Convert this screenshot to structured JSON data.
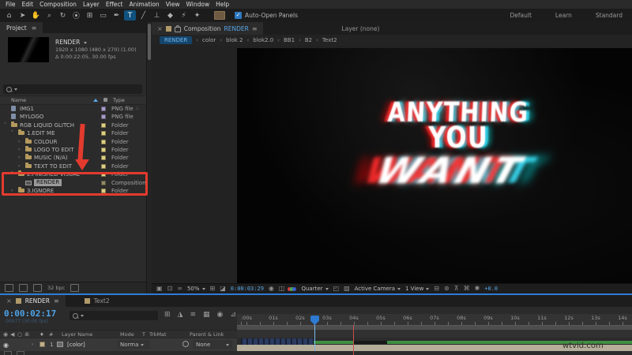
{
  "accent": {
    "blue": "#58a6e8",
    "red_annotation": "#e23b2e",
    "selection_blue": "#2e7cd6"
  },
  "menu_bar": {
    "items": [
      "File",
      "Edit",
      "Composition",
      "Layer",
      "Effect",
      "Animation",
      "View",
      "Window",
      "Help"
    ]
  },
  "toolbar": {
    "tools": [
      {
        "name": "home-tool",
        "glyph": "⌂",
        "active": false
      },
      {
        "name": "selection-tool",
        "glyph": "➤",
        "active": false
      },
      {
        "name": "hand-tool",
        "glyph": "✋",
        "active": false
      },
      {
        "name": "zoom-tool",
        "glyph": "⌕",
        "active": false
      },
      {
        "name": "rotation-tool",
        "glyph": "↻",
        "active": false
      },
      {
        "name": "camera-tool",
        "glyph": "⦿",
        "active": false
      },
      {
        "name": "pan-behind-tool",
        "glyph": "⊞",
        "active": false
      },
      {
        "name": "shape-tool",
        "glyph": "▭",
        "active": false
      },
      {
        "name": "pen-tool",
        "glyph": "✒",
        "active": false
      },
      {
        "name": "type-tool",
        "glyph": "T",
        "active": true
      },
      {
        "name": "brush-tool",
        "glyph": "╱",
        "active": false
      },
      {
        "name": "clone-stamp-tool",
        "glyph": "⊥",
        "active": false
      },
      {
        "name": "eraser-tool",
        "glyph": "◆",
        "active": false
      },
      {
        "name": "roto-brush-tool",
        "glyph": "⚡",
        "active": false
      },
      {
        "name": "puppet-pin-tool",
        "glyph": "✦",
        "active": false
      }
    ],
    "checkmark": "✓",
    "auto_open_label": "Auto-Open Panels",
    "workspaces": [
      "Default",
      "Learn",
      "Standard"
    ]
  },
  "project_panel": {
    "tab": "Project",
    "panel_menu_glyph": "≡",
    "preview": {
      "name": "RENDER",
      "meta1": "1920 x 1080  (480 x 270) (1.00)",
      "meta2": "Δ 0:00:22:05, 30.00 fps"
    },
    "columns": {
      "name": "Name",
      "type": "Type"
    },
    "items": [
      {
        "label": "IMG1",
        "type": "PNG file",
        "icon": "png",
        "indent": 0,
        "twirl": "",
        "swatch": "#a89cc8",
        "selected": false,
        "net": true
      },
      {
        "label": "MYLOGO",
        "type": "PNG file",
        "icon": "png",
        "indent": 0,
        "twirl": "",
        "swatch": "#a89cc8",
        "selected": false
      },
      {
        "label": "RGB LIQUID GLITCH",
        "type": "Folder",
        "icon": "folder",
        "indent": 0,
        "twirl": "v",
        "swatch": "#decf84",
        "selected": false
      },
      {
        "label": "1.EDIT ME",
        "type": "Folder",
        "icon": "folder",
        "indent": 1,
        "twirl": "v",
        "swatch": "#decf84",
        "selected": false
      },
      {
        "label": "COLOUR",
        "type": "Folder",
        "icon": "folder",
        "indent": 2,
        "twirl": ">",
        "swatch": "#decf84",
        "selected": false
      },
      {
        "label": "LOGO TO EDIT",
        "type": "Folder",
        "icon": "folder",
        "indent": 2,
        "twirl": ">",
        "swatch": "#decf84",
        "selected": false
      },
      {
        "label": "MUSIC (N/A)",
        "type": "Folder",
        "icon": "folder",
        "indent": 2,
        "twirl": ">",
        "swatch": "#decf84",
        "selected": false
      },
      {
        "label": "TEXT TO EDIT",
        "type": "Folder",
        "icon": "folder",
        "indent": 2,
        "twirl": ">",
        "swatch": "#decf84",
        "selected": false
      },
      {
        "label": "2.FINISHED VISUAL",
        "type": "Folder",
        "icon": "folder",
        "indent": 1,
        "twirl": "v",
        "swatch": "#decf84",
        "selected": false
      },
      {
        "label": "RENDER",
        "type": "Composition",
        "icon": "comp",
        "indent": 2,
        "twirl": "",
        "swatch": "#8f8a66",
        "selected": true
      },
      {
        "label": "3.IGNORE",
        "type": "Folder",
        "icon": "folder",
        "indent": 1,
        "twirl": ">",
        "swatch": "#decf84",
        "selected": false
      }
    ],
    "net_glyph": "∴",
    "footer": {
      "bit_depth": "32 bpc"
    }
  },
  "composition_panel": {
    "close_glyph": "×",
    "tab_prefix": "Composition",
    "tab_name": "RENDER",
    "panel_menu_glyph": "≡",
    "layer_tab": "Layer (none)",
    "crumb_sep": "‹",
    "breadcrumbs": [
      "RENDER",
      "color",
      "blok 2",
      "blok2.0",
      "BB1",
      "B2",
      "Text2"
    ],
    "glitch_text": {
      "line1": "ANYTHING",
      "line2": "YOU",
      "line3": "WANT"
    },
    "toolbar_tokens": [
      {
        "k": "icon",
        "name": "always-preview-icon",
        "g": "▣"
      },
      {
        "k": "icon",
        "name": "main-viewer-icon",
        "g": "⊡"
      },
      {
        "k": "icon",
        "name": "vr-view-icon",
        "g": "∞"
      },
      {
        "k": "select",
        "name": "magnification-select",
        "v": "50%"
      },
      {
        "k": "icon",
        "name": "grid-guides-icon",
        "g": "⊞"
      },
      {
        "k": "icon",
        "name": "mask-visibility-icon",
        "g": "◪"
      },
      {
        "k": "time",
        "name": "preview-timecode",
        "v": "0:00:03:29"
      },
      {
        "k": "icon",
        "name": "snapshot-icon",
        "g": "◉"
      },
      {
        "k": "icon",
        "name": "show-snapshot-icon",
        "g": "◫"
      },
      {
        "k": "rgb",
        "name": "show-channel-icon"
      },
      {
        "k": "select",
        "name": "resolution-select",
        "v": "Quarter"
      },
      {
        "k": "icon",
        "name": "region-of-interest-icon",
        "g": "◰"
      },
      {
        "k": "icon",
        "name": "transparency-grid-icon",
        "g": "▨"
      },
      {
        "k": "select",
        "name": "camera-select",
        "v": "Active Camera"
      },
      {
        "k": "select",
        "name": "view-layout-select",
        "v": "1 View"
      },
      {
        "k": "icon",
        "name": "pixel-aspect-icon",
        "g": "⊟"
      },
      {
        "k": "icon",
        "name": "fast-previews-icon",
        "g": "⊛"
      },
      {
        "k": "icon",
        "name": "timeline-button-icon",
        "g": "⊼"
      },
      {
        "k": "icon",
        "name": "flowchart-button-icon",
        "g": "⌘"
      },
      {
        "k": "icon",
        "name": "adjust-exposure-icon",
        "g": "✱"
      },
      {
        "k": "time",
        "name": "exposure-value",
        "v": "+0.0"
      }
    ]
  },
  "timeline_panel": {
    "close_glyph": "×",
    "tabs": [
      {
        "label": "RENDER",
        "active": true
      },
      {
        "label": "Text2",
        "active": false
      }
    ],
    "panel_menu_glyph": "≡",
    "timecode": "0:00:02:17",
    "frame_info": "00077 (30.00 fps)",
    "toolbar_icons": [
      {
        "name": "comp-flowchart-icon",
        "g": "⊞"
      },
      {
        "name": "draft-3d-icon",
        "g": "◮"
      },
      {
        "name": "shy-layers-icon",
        "g": "≋"
      },
      {
        "name": "frame-blending-icon",
        "g": "▦"
      },
      {
        "name": "motion-blur-icon",
        "g": "◉"
      },
      {
        "name": "graph-editor-icon",
        "g": "⊿"
      }
    ],
    "ruler_ticks": [
      ":00s",
      "01s",
      "02s",
      "03s",
      "04s",
      "05s",
      "06s",
      "07s",
      "08s",
      "09s",
      "10s",
      "11s",
      "12s",
      "13s",
      "14s"
    ],
    "columns": {
      "av_glyphs": [
        "◉",
        "◀",
        "○",
        "⋒"
      ],
      "layer_name": "Layer Name",
      "mode": "Mode",
      "t": "T",
      "trkmat": "TrkMat",
      "parent": "Parent & Link"
    },
    "layer": {
      "eye": "◉",
      "twirl": "›",
      "num": "1",
      "name": "[color]",
      "mode": "Norma",
      "parent": "None"
    },
    "watermark": "wtvid.com"
  }
}
